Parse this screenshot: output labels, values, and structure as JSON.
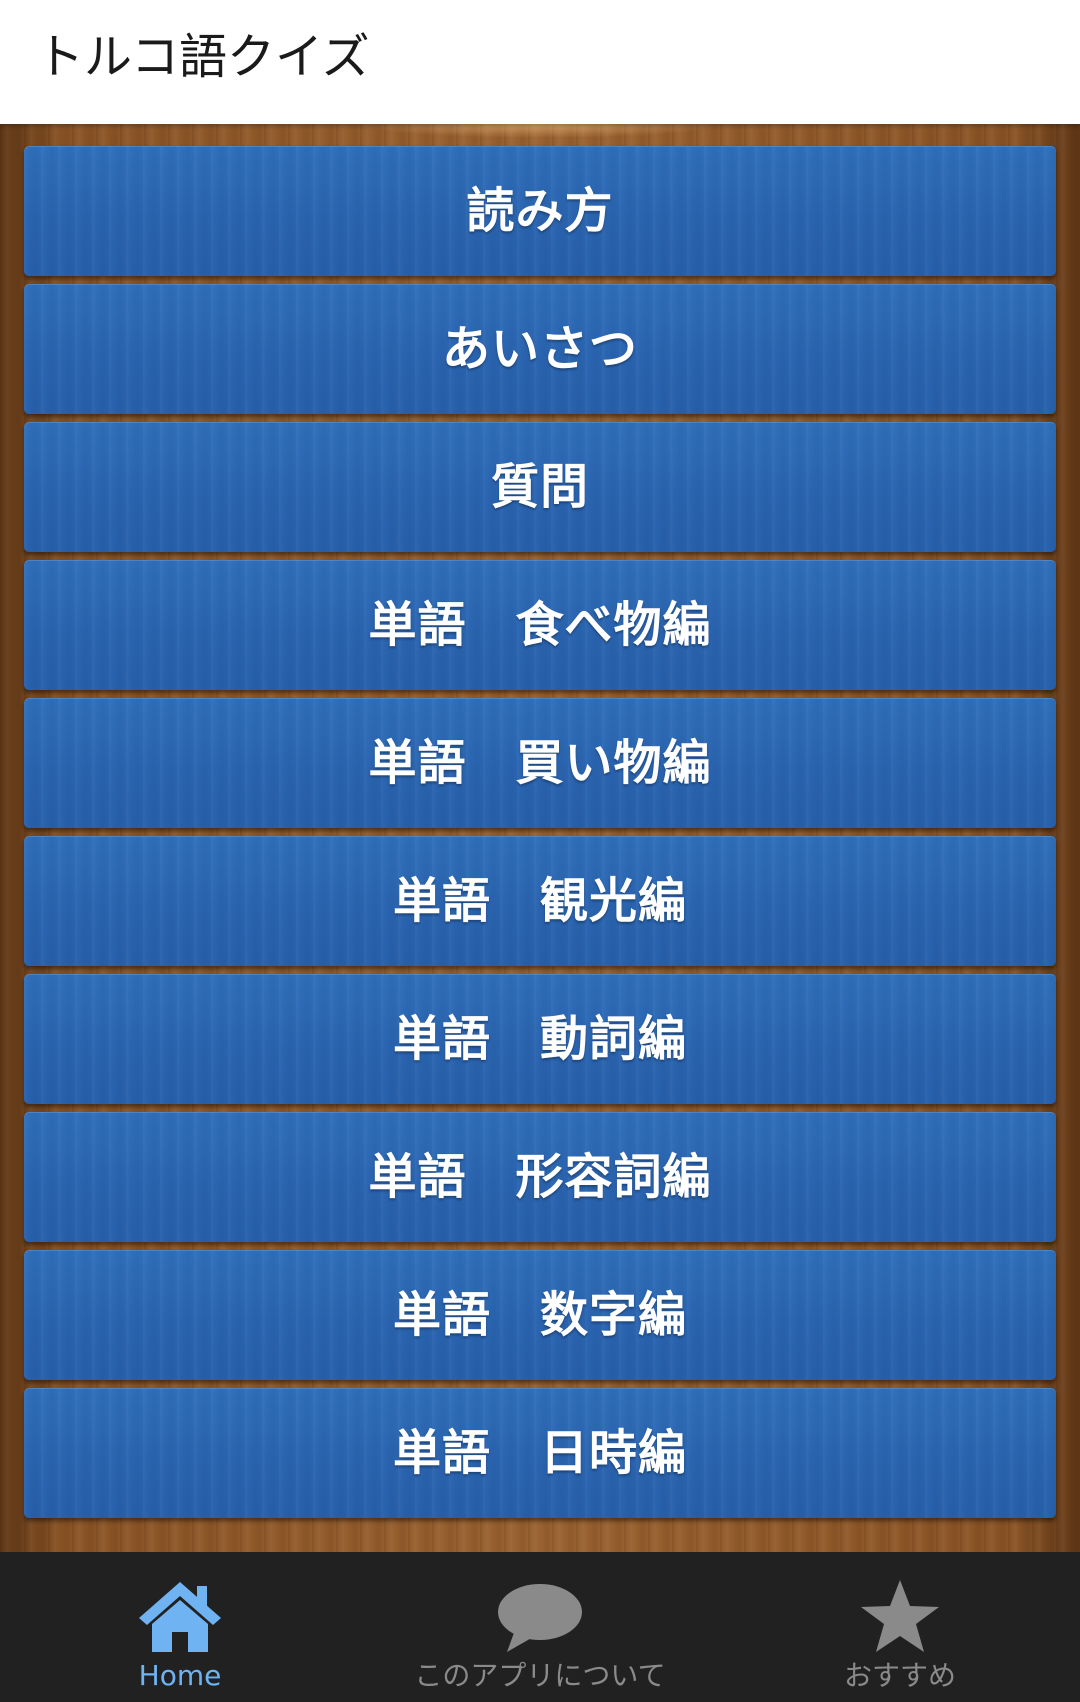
{
  "app_bar": {
    "title": "トルコ語クイズ"
  },
  "menu": {
    "items": [
      {
        "label": "読み方"
      },
      {
        "label": "あいさつ"
      },
      {
        "label": "質問"
      },
      {
        "label": "単語　食べ物編"
      },
      {
        "label": "単語　買い物編"
      },
      {
        "label": "単語　観光編"
      },
      {
        "label": "単語　動詞編"
      },
      {
        "label": "単語　形容詞編"
      },
      {
        "label": "単語　数字編"
      },
      {
        "label": "単語　日時編"
      }
    ]
  },
  "bottom_nav": {
    "items": [
      {
        "label": "Home",
        "icon": "home-icon",
        "active": true
      },
      {
        "label": "このアプリについて",
        "icon": "chat-bubble-icon",
        "active": false
      },
      {
        "label": "おすすめ",
        "icon": "star-icon",
        "active": false
      }
    ]
  },
  "colors": {
    "button": "#2a64b0",
    "nav_active": "#6fb3f2",
    "nav_inactive": "#8a8a8a",
    "nav_background": "#212121",
    "wood": "#8a5425"
  }
}
